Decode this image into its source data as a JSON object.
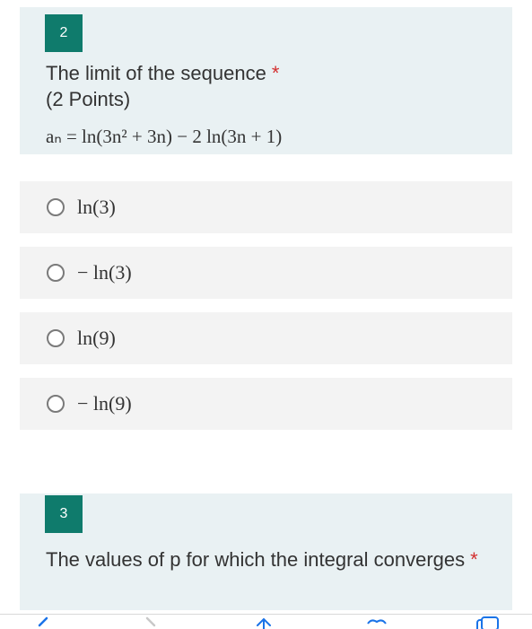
{
  "question2": {
    "number": "2",
    "title": "The limit of the sequence",
    "required_mark": "*",
    "points": "(2 Points)",
    "formula": "aₙ = ln(3n² + 3n) − 2 ln(3n + 1)"
  },
  "options": [
    {
      "label": "ln(3)"
    },
    {
      "label": "− ln(3)"
    },
    {
      "label": "ln(9)"
    },
    {
      "label": "− ln(9)"
    }
  ],
  "question3": {
    "number": "3",
    "title": "The values of p for which the integral converges",
    "required_mark": "*"
  },
  "toolbar": {
    "icons": [
      "back-icon",
      "forward-icon",
      "share-icon",
      "bookmarks-icon",
      "tabs-icon"
    ],
    "accent_color": "#1a73e8"
  },
  "colors": {
    "question_badge": "#0f7b6c",
    "card_background": "#e9f1f3",
    "option_background": "#f3f3f3",
    "required": "#d32f2f"
  }
}
